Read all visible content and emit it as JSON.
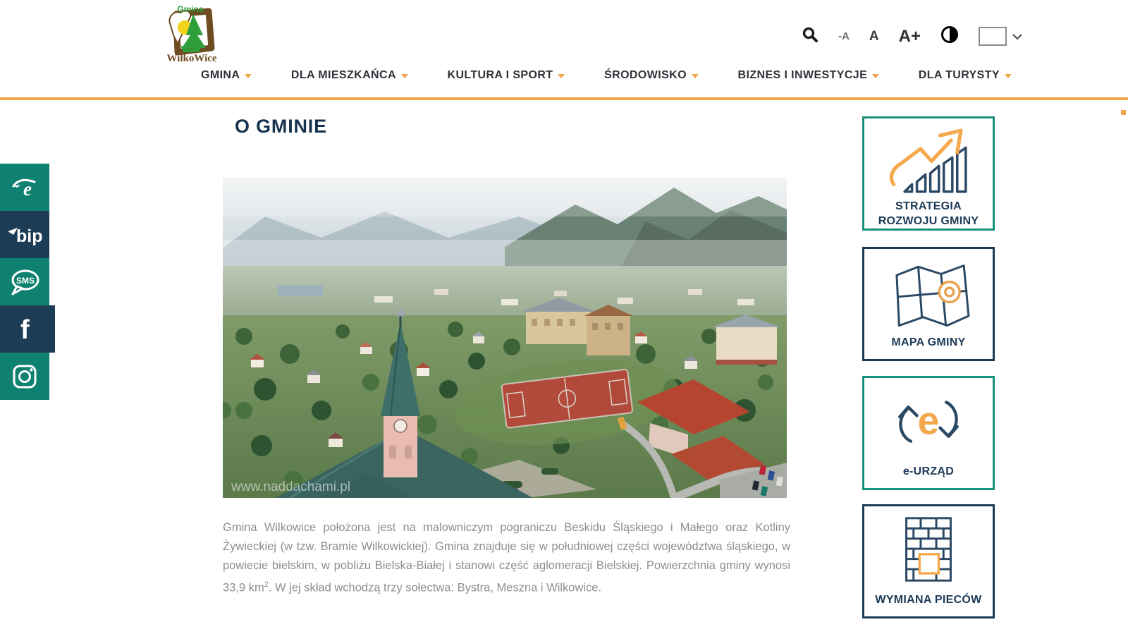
{
  "header": {
    "logo": {
      "top_text": "Gmina",
      "bottom_text": "WilkoWice"
    },
    "tools": {
      "search_icon": "magnifier",
      "font_smaller": "-A",
      "font_normal": "A",
      "font_larger": "A+",
      "contrast_icon": "half-filled-circle",
      "language": {
        "flag": "poland-flag",
        "chevron": "chevron-down"
      }
    },
    "nav": {
      "items": [
        {
          "label": "GMINA"
        },
        {
          "label": "DLA MIESZKAŃCA"
        },
        {
          "label": "KULTURA I SPORT"
        },
        {
          "label": "ŚRODOWISKO"
        },
        {
          "label": "BIZNES I INWESTYCJE"
        },
        {
          "label": "DLA TURYSTY"
        }
      ]
    }
  },
  "social_sidebar": {
    "items": [
      {
        "name": "epuap",
        "label": "e"
      },
      {
        "name": "bip",
        "label": "bip"
      },
      {
        "name": "sms",
        "label": "SMS"
      },
      {
        "name": "facebook",
        "label": "f"
      },
      {
        "name": "instagram",
        "label": ""
      }
    ]
  },
  "main": {
    "page_title": "O GMINIE",
    "photo": {
      "watermark": "www.naddachami.pl"
    },
    "paragraph": {
      "text_before_sup": "Gmina Wilkowice położona jest na malowniczym pograniczu Beskidu Śląskiego i Małego oraz Kotliny Żywieckiej (w tzw. Bramie Wilkowickiej). Gmina znajduje się w południowej części województwa śląskiego, w powiecie bielskim, w pobliżu Bielska-Białej i stanowi część aglomeracji Bielskiej. Powierzchnia gminy wynosi 33,9 km",
      "sup": "2",
      "text_after_sup": ". W jej skład wchodzą trzy sołectwa: Bystra, Meszna i Wilkowice."
    }
  },
  "quick_links": {
    "boxes": [
      {
        "icon": "growth-chart",
        "label_line1": "STRATEGIA",
        "label_line2": "ROZWOJU GMINY"
      },
      {
        "icon": "map",
        "label_line1": "MAPA GMINY"
      },
      {
        "icon": "e-office-arrows",
        "label_line1": "e-URZĄD"
      },
      {
        "icon": "brick-stove",
        "label_line1": "WYMIANA PIECÓW"
      }
    ]
  },
  "colors": {
    "accent_orange": "#F0A54B",
    "navy": "#1C3A56",
    "teal_border": "#17917B",
    "sidebar_teal": "#0F8170",
    "sidebar_navy": "#1D3C55",
    "flag_red": "#D2223E",
    "heading_navy": "#16324E",
    "paragraph_gray": "#8E8E90"
  }
}
